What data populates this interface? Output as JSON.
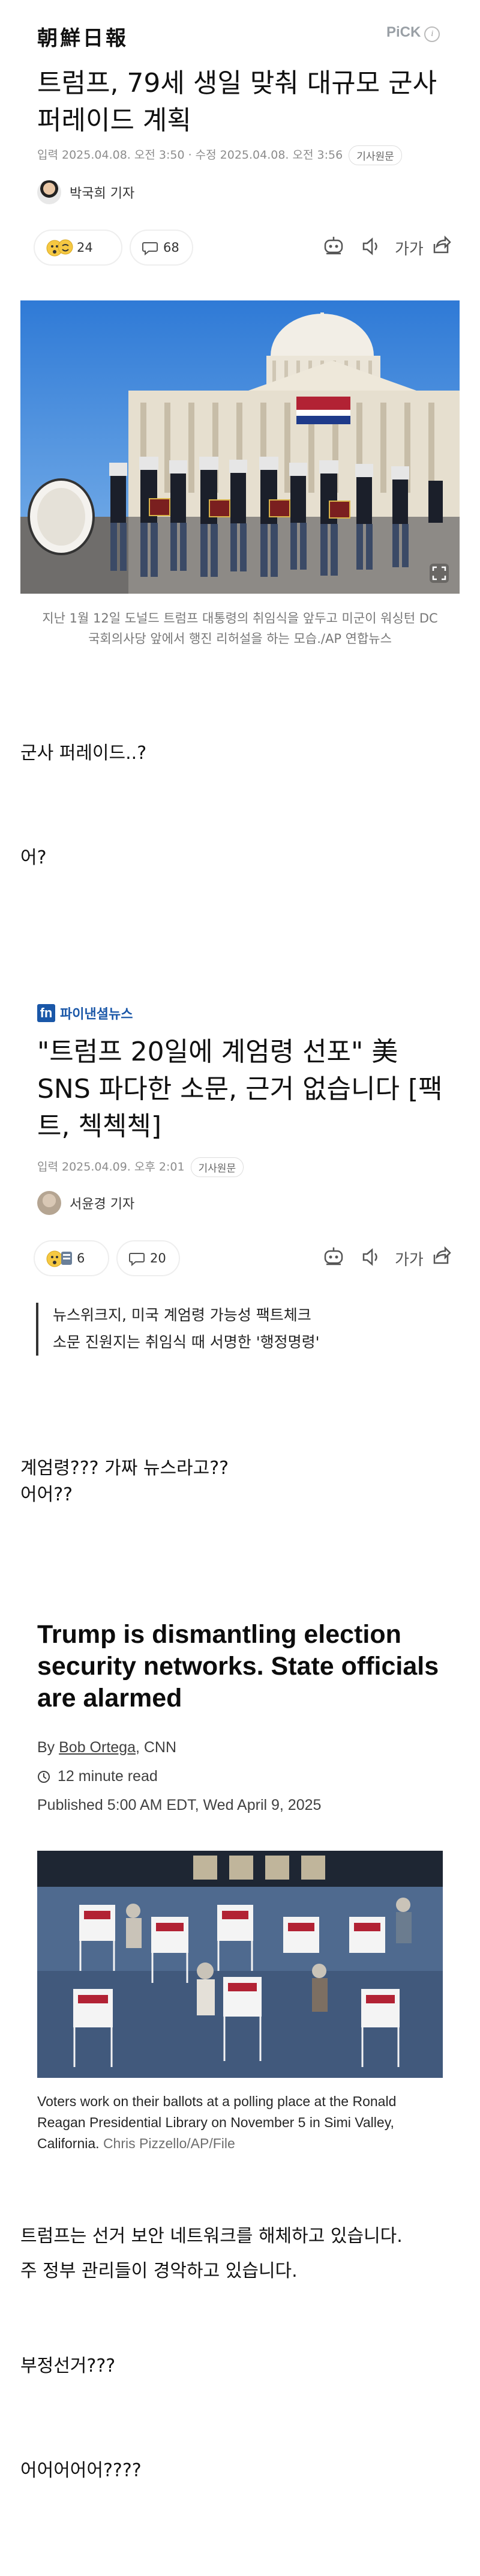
{
  "article1": {
    "publisher": "朝鮮日報",
    "pick_label": "PiCK",
    "info_glyph": "i",
    "headline": "트럼프, 79세 생일 맞춰 대규모 군사 퍼레이드 계획",
    "meta": "입력 2025.04.08. 오전 3:50 · 수정 2025.04.08. 오전 3:56",
    "original_label": "기사원문",
    "author": "박국희 기자",
    "reaction_count": "24",
    "comment_count": "68",
    "font_size_label": "가가",
    "photo_caption": "지난 1월 12일 도널드 트럼프 대통령의 취임식을 앞두고 미군이 워싱턴 DC 국회의사당 앞에서 행진 리허설을 하는 모습./AP 연합뉴스"
  },
  "comment1": "군사 퍼레이드..?",
  "comment2": "어?",
  "article2": {
    "publisher": "파이낸셜뉴스",
    "headline": "\"트럼프 20일에 계엄령 선포\" 美 SNS 파다한 소문, 근거 없습니다 [팩트, 첵첵첵]",
    "meta": "입력 2025.04.09. 오후 2:01",
    "original_label": "기사원문",
    "author": "서윤경 기자",
    "reaction_count": "6",
    "comment_count": "20",
    "font_size_label": "가가",
    "quote_line1": "뉴스위크지, 미국 계엄령 가능성 팩트체크",
    "quote_line2": "소문 진원지는 취임식 때 서명한 '행정명령'"
  },
  "comment3_line1": "계엄령??? 가짜 뉴스라고??",
  "comment3_line2": "어어??",
  "article3": {
    "headline": "Trump is dismantling election security networks. State officials are alarmed",
    "byline_prefix": "By ",
    "byline_author": "Bob Ortega",
    "byline_suffix": ", CNN",
    "read_time": "12 minute read",
    "published": "Published 5:00 AM EDT, Wed April 9, 2025",
    "photo_caption": "Voters work on their ballots at a polling place at the Ronald Reagan Presidential Library on November 5 in Simi Valley, California.",
    "photo_credit": "Chris Pizzello/AP/File"
  },
  "translation_line1": "트럼프는 선거 보안 네트워크를 해체하고 있습니다.",
  "translation_line2": "주 정부 관리들이 경악하고 있습니다.",
  "comment4": "부정선거???",
  "comment5": "어어어어어????",
  "icons": {
    "speaker_icon": "speaker-icon",
    "share_icon": "share-icon",
    "comment_icon": "comment-icon",
    "clock_icon": "clock-icon",
    "fullscreen_icon": "fullscreen-icon",
    "quote_icon": "quote-icon"
  },
  "colors": {
    "fn_brand": "#1a57a8",
    "cnn_text": "#0c0c0c",
    "muted": "#8c8c8c"
  }
}
